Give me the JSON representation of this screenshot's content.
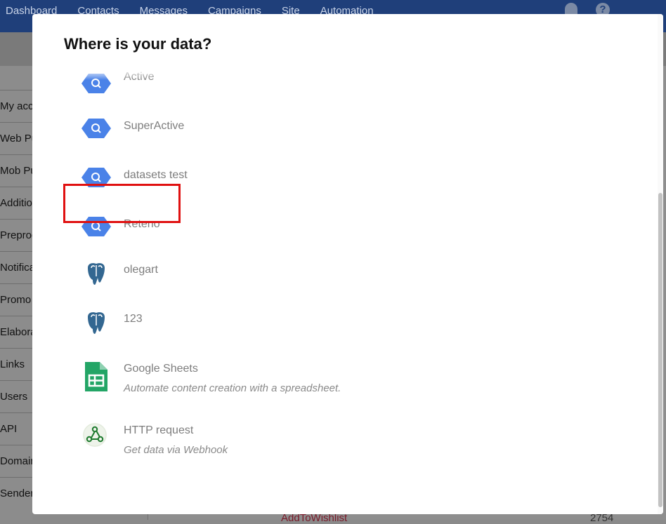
{
  "app": {
    "nav": [
      "Dashboard",
      "Contacts",
      "Messages",
      "Campaigns",
      "Site",
      "Automation"
    ],
    "sidebar": [
      "My acco",
      "Web Pu",
      "Mob Pu",
      "Additio",
      "Preproc",
      "Notifica",
      "Promo c",
      "Elaborat",
      "Links",
      "Users",
      "API",
      "Domain",
      "Senders"
    ],
    "bottom_text": "AddToWishlist",
    "bottom_number": "2754"
  },
  "modal": {
    "title": "Where is your data?",
    "sources": [
      {
        "name": "Active",
        "icon": "bigquery-icon"
      },
      {
        "name": "SuperActive",
        "icon": "bigquery-icon"
      },
      {
        "name": "datasets test",
        "icon": "bigquery-icon"
      },
      {
        "name": "Reteno",
        "icon": "bigquery-icon",
        "highlighted": true
      },
      {
        "name": "olegart",
        "icon": "postgresql-icon"
      },
      {
        "name": "123",
        "icon": "postgresql-icon"
      },
      {
        "name": "Google Sheets",
        "description": "Automate content creation with a spreadsheet.",
        "icon": "google-sheets-icon"
      },
      {
        "name": "HTTP request",
        "description": "Get data via Webhook",
        "icon": "webhook-icon"
      }
    ]
  },
  "colors": {
    "highlight": "#e01010",
    "bigquery": "#4a82e8",
    "postgres": "#336791",
    "sheets": "#23a566"
  }
}
